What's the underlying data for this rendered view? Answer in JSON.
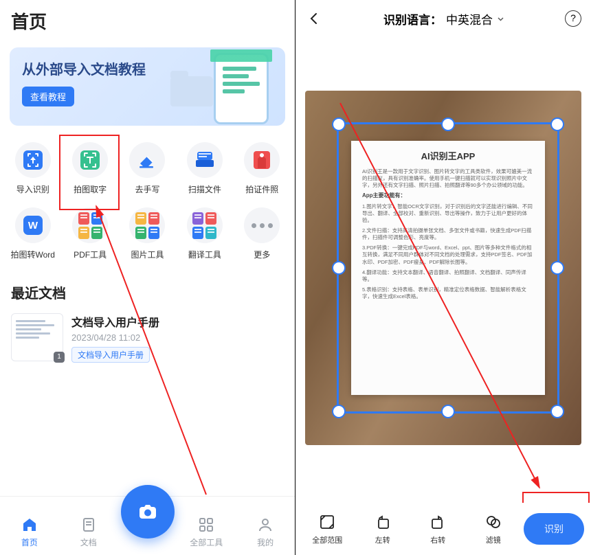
{
  "left": {
    "title": "首页",
    "banner": {
      "title": "从外部导入文档教程",
      "button": "查看教程"
    },
    "tools": [
      {
        "name": "import-recognize",
        "label": "导入识别"
      },
      {
        "name": "photo-extract-text",
        "label": "拍图取字"
      },
      {
        "name": "remove-handwriting",
        "label": "去手写"
      },
      {
        "name": "scan-file",
        "label": "扫描文件"
      },
      {
        "name": "id-photo",
        "label": "拍证件照"
      },
      {
        "name": "photo-to-word",
        "label": "拍图转Word"
      },
      {
        "name": "pdf-tools",
        "label": "PDF工具"
      },
      {
        "name": "image-tools",
        "label": "图片工具"
      },
      {
        "name": "translate-tools",
        "label": "翻译工具"
      },
      {
        "name": "more",
        "label": "更多"
      }
    ],
    "recent_title": "最近文档",
    "doc": {
      "name": "文档导入用户手册",
      "date": "2023/04/28 11:02",
      "tag": "文档导入用户手册",
      "badge": "1"
    },
    "tabs": [
      {
        "name": "home",
        "label": "首页",
        "active": true
      },
      {
        "name": "docs",
        "label": "文档"
      },
      {
        "name": "all-tools",
        "label": "全部工具"
      },
      {
        "name": "mine",
        "label": "我的"
      }
    ]
  },
  "right": {
    "lang_label": "识别语言：",
    "lang_value": "中英混合",
    "paper": {
      "title": "AI识别王APP",
      "p1": "AI识别王是一款用于文字识别、图片转文字的工具类软件，效果可媲美一流的扫描仪，具有识别准确率。使用手机一键扫描就可以实现识别照片中文字，另外还有文字扫描、照片扫描、拍照翻译等90多个办公领域的功能。",
      "sub": "App主要功能有：",
      "p2": "1.图片转文字：智能OCR文字识别，对于识别后的文字还能进行编辑、不同导出、翻译、全部校对、重新识别、导出等操作，致力于让用户更好的体验。",
      "p3": "2.文件扫描：支持高清拍摄单张文档、多张文件或书籍，快速生成PDF扫描件，扫描件可调整色彩、亮度等。",
      "p4": "3.PDF转换：一键完成PDF与word、Excel、ppt、图片等多种文件格式的相互转换，满足不同用户群体对不同文档的处理需求，支持PDF签名、PDF加水印、PDF加密、PDF瘦身、PDF解除长图等。",
      "p5": "4.翻译功能：支持文本翻译、语音翻译、拍照翻译、文档翻译、同声传译等。",
      "p6": "5.表格识别：支持表格、表单识别，精准定位表格数据、智能解析表格文字，快速生成Excel表格。"
    },
    "tools": [
      {
        "name": "full-range",
        "label": "全部范围"
      },
      {
        "name": "rotate-left",
        "label": "左转"
      },
      {
        "name": "rotate-right",
        "label": "右转"
      },
      {
        "name": "filter",
        "label": "滤镜"
      }
    ],
    "main_button": "识别"
  }
}
